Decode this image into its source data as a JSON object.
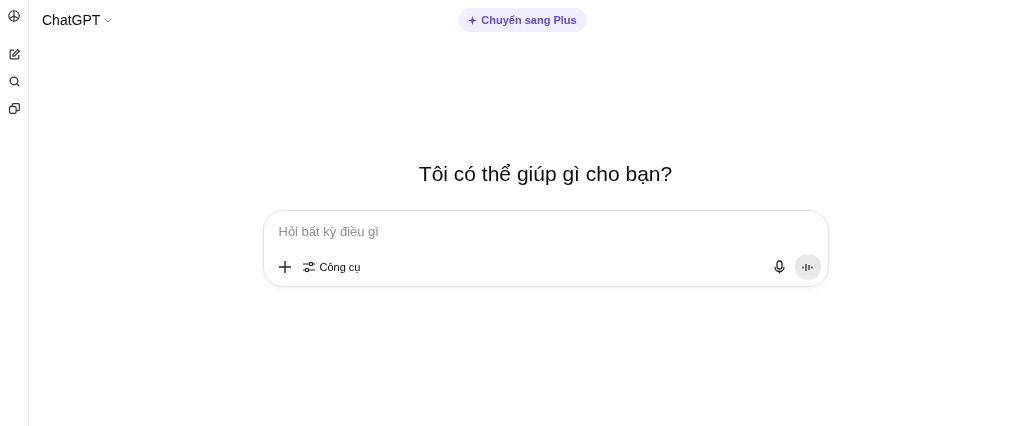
{
  "header": {
    "model_name": "ChatGPT",
    "upgrade_button": "Chuyển sang Plus"
  },
  "heading": "Tôi có thể giúp gì cho bạn?",
  "composer": {
    "placeholder": "Hỏi bất kỳ điều gì",
    "tools_button": "Công cụ"
  }
}
